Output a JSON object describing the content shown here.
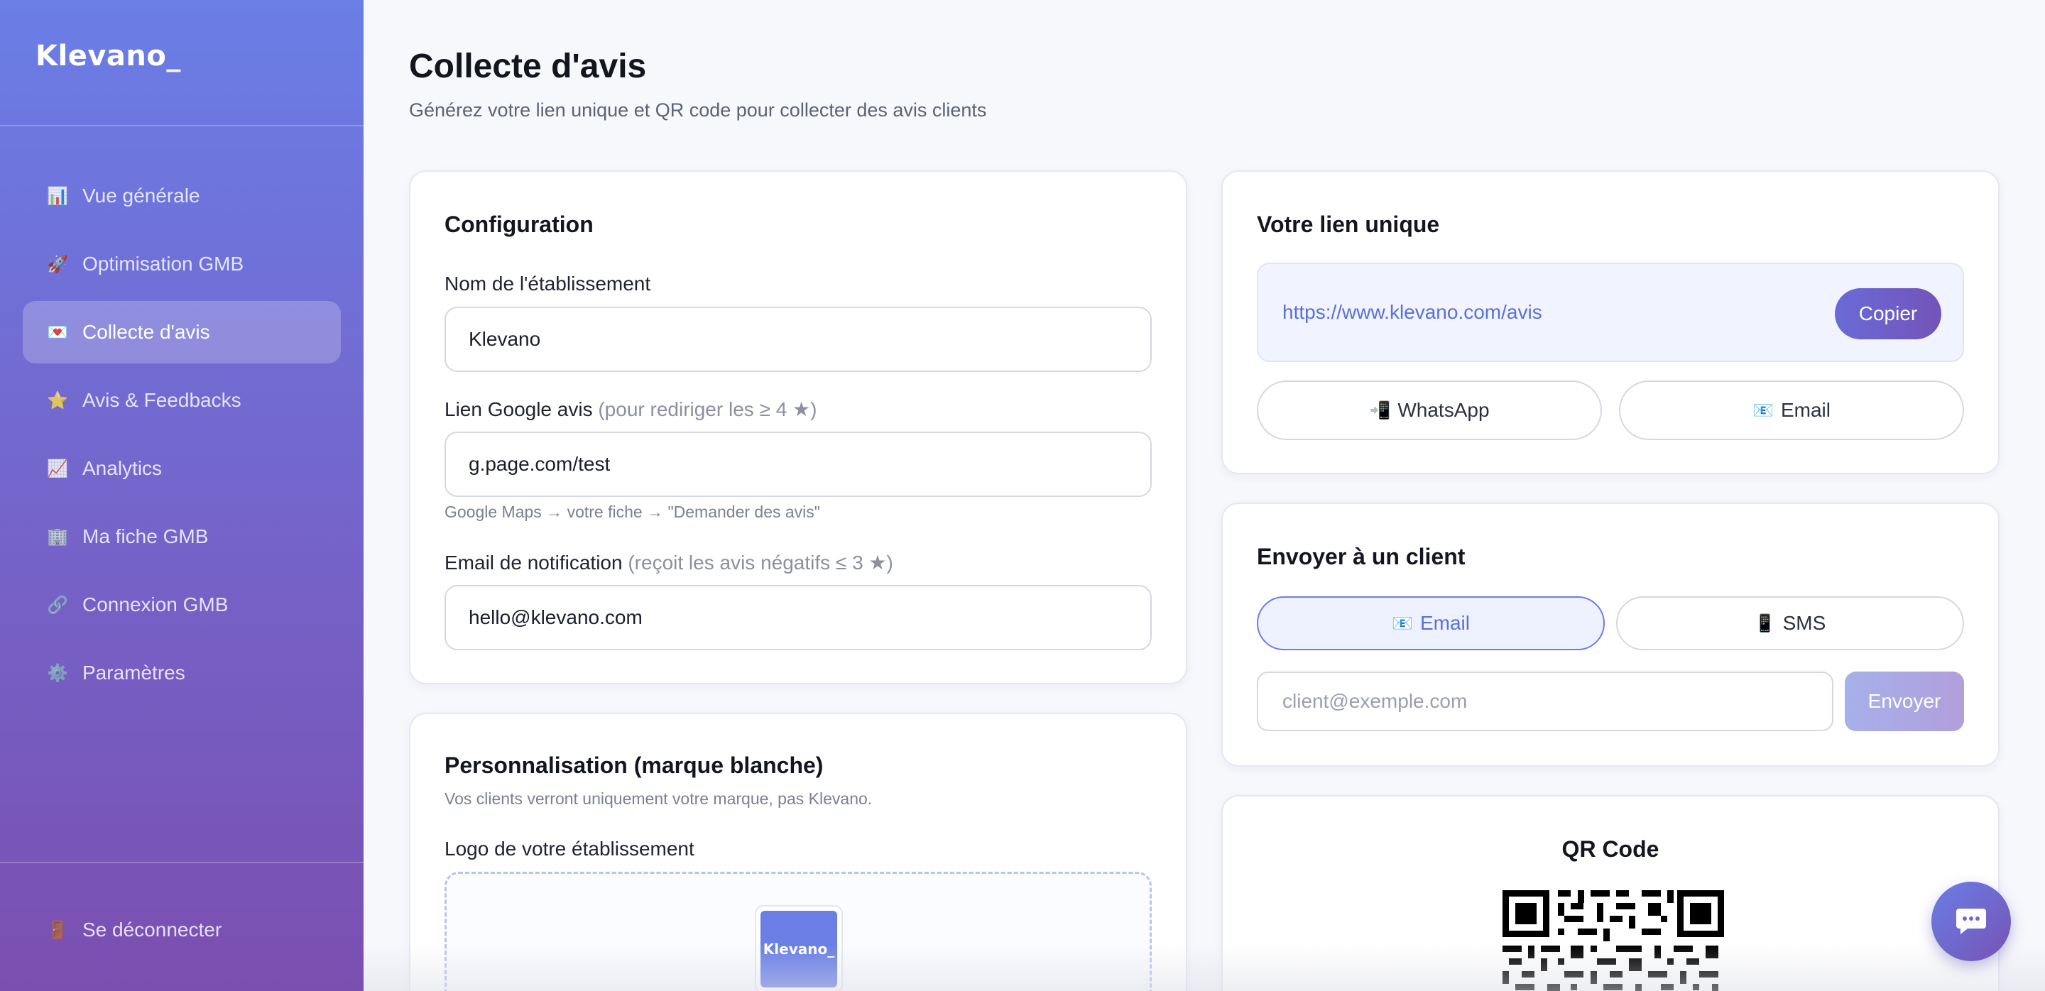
{
  "brand": {
    "logo_text": "Klevano",
    "logo_cursor": "_"
  },
  "sidebar": {
    "items": [
      {
        "icon": "📊",
        "icon_name": "bar-chart-icon",
        "label": "Vue générale",
        "active": false
      },
      {
        "icon": "🚀",
        "icon_name": "rocket-icon",
        "label": "Optimisation GMB",
        "active": false
      },
      {
        "icon": "💌",
        "icon_name": "love-letter-icon",
        "label": "Collecte d'avis",
        "active": true
      },
      {
        "icon": "⭐",
        "icon_name": "star-icon",
        "label": "Avis & Feedbacks",
        "active": false
      },
      {
        "icon": "📈",
        "icon_name": "trend-chart-icon",
        "label": "Analytics",
        "active": false
      },
      {
        "icon": "🏢",
        "icon_name": "building-icon",
        "label": "Ma fiche GMB",
        "active": false
      },
      {
        "icon": "🔗",
        "icon_name": "link-icon",
        "label": "Connexion GMB",
        "active": false
      },
      {
        "icon": "⚙️",
        "icon_name": "gear-icon",
        "label": "Paramètres",
        "active": false
      }
    ],
    "logout": {
      "icon": "🚪",
      "label": "Se déconnecter"
    }
  },
  "header": {
    "title": "Collecte d'avis",
    "subtitle": "Générez votre lien unique et QR code pour collecter des avis clients"
  },
  "config": {
    "title": "Configuration",
    "name_label": "Nom de l'établissement",
    "name_value": "Klevano",
    "google_label": "Lien Google avis",
    "google_label_note": "(pour rediriger les ≥ 4 ★)",
    "google_value": "g.page.com/test",
    "google_hint": "Google Maps → votre fiche → \"Demander des avis\"",
    "email_label": "Email de notification",
    "email_label_note": "(reçoit les avis négatifs ≤ 3 ★)",
    "email_value": "hello@klevano.com"
  },
  "branding": {
    "title": "Personnalisation (marque blanche)",
    "subtitle": "Vos clients verront uniquement votre marque, pas Klevano.",
    "logo_label": "Logo de votre établissement",
    "logo_preview_text": "Klevano_"
  },
  "unique_link": {
    "title": "Votre lien unique",
    "url": "https://www.klevano.com/avis",
    "copy_label": "Copier",
    "whatsapp_icon": "📲",
    "whatsapp_label": "WhatsApp",
    "email_icon": "📧",
    "email_label": "Email"
  },
  "send_client": {
    "title": "Envoyer à un client",
    "tab_email_icon": "📧",
    "tab_email": "Email",
    "tab_sms_icon": "📱",
    "tab_sms": "SMS",
    "placeholder": "client@exemple.com",
    "send_label": "Envoyer"
  },
  "qr": {
    "title": "QR Code"
  },
  "colors": {
    "accent": "#6a7ee6",
    "accent_dark": "#7353b8",
    "link": "#5b6fd8"
  }
}
